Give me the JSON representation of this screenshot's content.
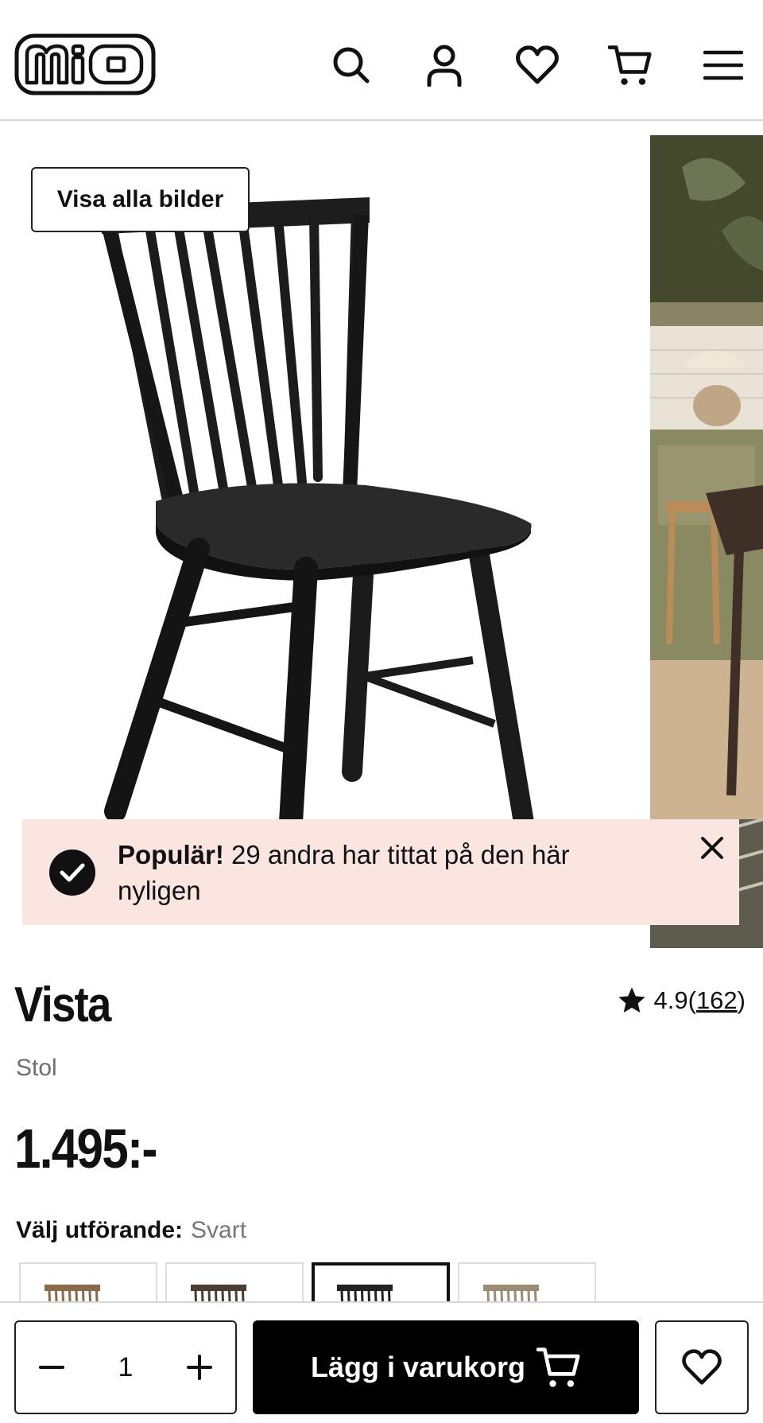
{
  "header": {
    "logo_text": "mio",
    "icons": [
      "search-icon",
      "user-icon",
      "heart-icon",
      "cart-icon",
      "menu-icon"
    ]
  },
  "gallery": {
    "show_all_label": "Visa alla bilder"
  },
  "banner": {
    "bold": "Populär!",
    "text": " 29 andra har tittat på den här nyligen"
  },
  "product": {
    "name": "Vista",
    "category": "Stol",
    "rating": "4.9",
    "rating_open": " (",
    "review_count": "162",
    "rating_close": ")",
    "price": "1.495:-"
  },
  "variant": {
    "label": "Välj utförande:",
    "selected": "Svart",
    "swatch_colors": [
      "#8a6a48",
      "#4a3d34",
      "#222222",
      "#9c8a72"
    ],
    "selected_index": 2
  },
  "bottom_bar": {
    "quantity": "1",
    "add_to_cart_label": "Lägg i varukorg"
  }
}
